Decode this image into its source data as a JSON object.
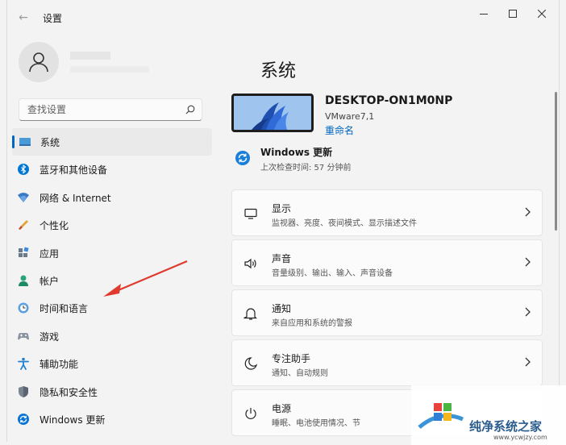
{
  "titlebar": {
    "title": "设置",
    "back_icon": "back-arrow-icon",
    "minimize_icon": "minimize-icon",
    "maximize_icon": "maximize-icon",
    "close_icon": "close-icon"
  },
  "user": {
    "avatar_icon": "user-avatar-icon"
  },
  "search": {
    "placeholder": "查找设置",
    "value": "",
    "icon": "search-icon"
  },
  "nav": {
    "items": [
      {
        "label": "系统",
        "icon": "monitor-icon",
        "selected": true
      },
      {
        "label": "蓝牙和其他设备",
        "icon": "bluetooth-icon"
      },
      {
        "label": "网络 & Internet",
        "icon": "wifi-icon"
      },
      {
        "label": "个性化",
        "icon": "paintbrush-icon"
      },
      {
        "label": "应用",
        "icon": "apps-icon"
      },
      {
        "label": "帐户",
        "icon": "account-icon"
      },
      {
        "label": "时间和语言",
        "icon": "clock-globe-icon"
      },
      {
        "label": "游戏",
        "icon": "gamepad-icon"
      },
      {
        "label": "辅助功能",
        "icon": "accessibility-icon"
      },
      {
        "label": "隐私和安全性",
        "icon": "shield-icon"
      },
      {
        "label": "Windows 更新",
        "icon": "windows-update-icon"
      }
    ]
  },
  "main": {
    "title": "系统",
    "device": {
      "name": "DESKTOP-ON1M0NP",
      "model": "VMware7,1",
      "rename": "重命名"
    },
    "update": {
      "title": "Windows 更新",
      "subtitle": "上次检查时间: 57 分钟前"
    },
    "cards": [
      {
        "title": "显示",
        "desc": "监视器、亮度、夜间模式、显示描述文件",
        "icon": "display-icon"
      },
      {
        "title": "声音",
        "desc": "音量级别、输出、输入、声音设备",
        "icon": "speaker-icon"
      },
      {
        "title": "通知",
        "desc": "来自应用和系统的警报",
        "icon": "bell-icon"
      },
      {
        "title": "专注助手",
        "desc": "通知、自动规则",
        "icon": "moon-icon"
      },
      {
        "title": "电源",
        "desc": "睡眠、电池使用情况、节",
        "icon": "power-icon"
      }
    ]
  },
  "watermark": {
    "text": "纯净系统之家",
    "url": "www.ycwjzy.com"
  },
  "colors": {
    "accent": "#0067c0",
    "annotation_arrow": "#e03a2e"
  }
}
